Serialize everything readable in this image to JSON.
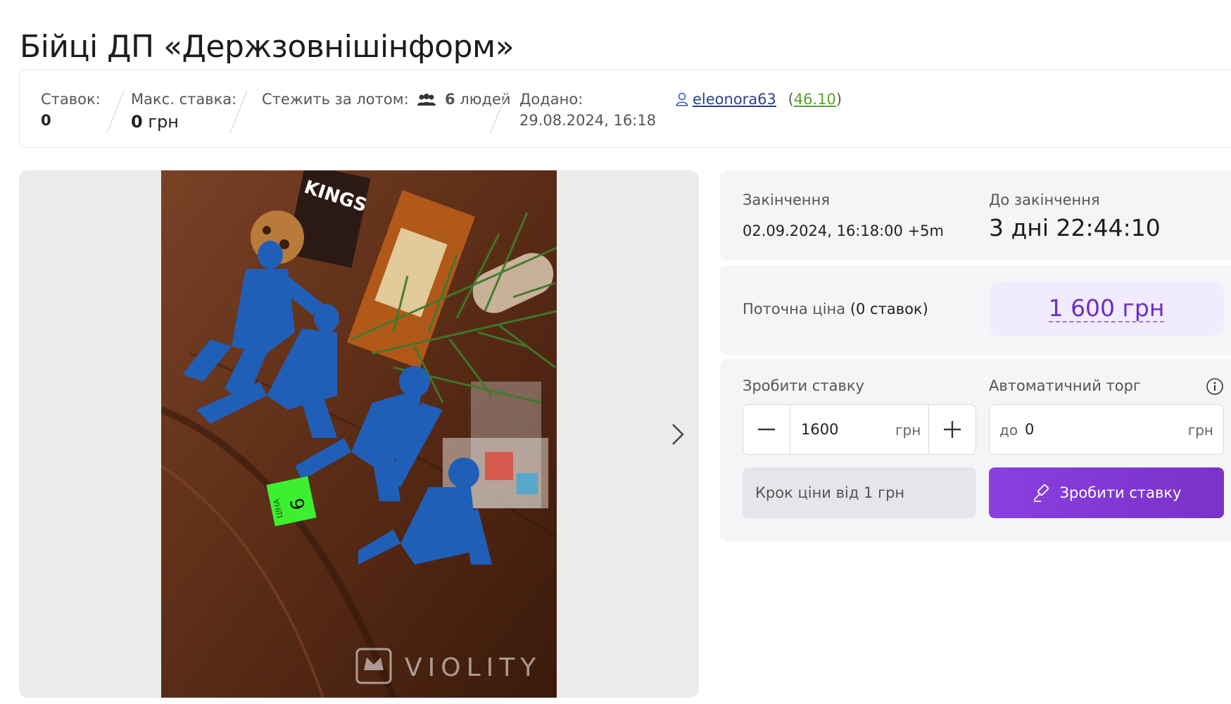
{
  "title": "Бійці ДП «Держзовнішінформ»",
  "stats": {
    "bids_label": "Ставок:",
    "bids_value": "0",
    "max_bid_label": "Макс. ставка:",
    "max_bid_amount": "0",
    "max_bid_currency": "грн",
    "watchers_label": "Стежить за лотом:",
    "watchers_count": "6",
    "watchers_unit": "людей",
    "added_label": "Додано:",
    "added_value": "29.08.2024, 16:18",
    "seller_name": "eleonora63",
    "seller_rating": "46.10"
  },
  "gallery": {
    "watermark": "VIOLITY",
    "sticker_text": "ЦІНА"
  },
  "auction": {
    "end_label": "Закінчення",
    "end_value": "02.09.2024, 16:18:00 +5m",
    "remaining_label": "До закінчення",
    "remaining_value": "3 дні 22:44:10",
    "current_price_label": "Поточна ціна",
    "current_price_bids": "(0 ставок)",
    "current_price_value": "1 600 грн"
  },
  "bid_form": {
    "bid_label": "Зробити ставку",
    "bid_value": "1600",
    "bid_currency": "грн",
    "auto_label": "Автоматичний торг",
    "auto_prefix": "до",
    "auto_value": "0",
    "auto_currency": "грн",
    "step_text": "Крок ціни від 1 грн",
    "submit_label": "Зробити ставку"
  },
  "colors": {
    "accent": "#7a32c8",
    "price_bg": "#f1ebff",
    "price_text": "#6a2ec6",
    "rating": "#5aa02c",
    "link": "#2a3f8f"
  }
}
